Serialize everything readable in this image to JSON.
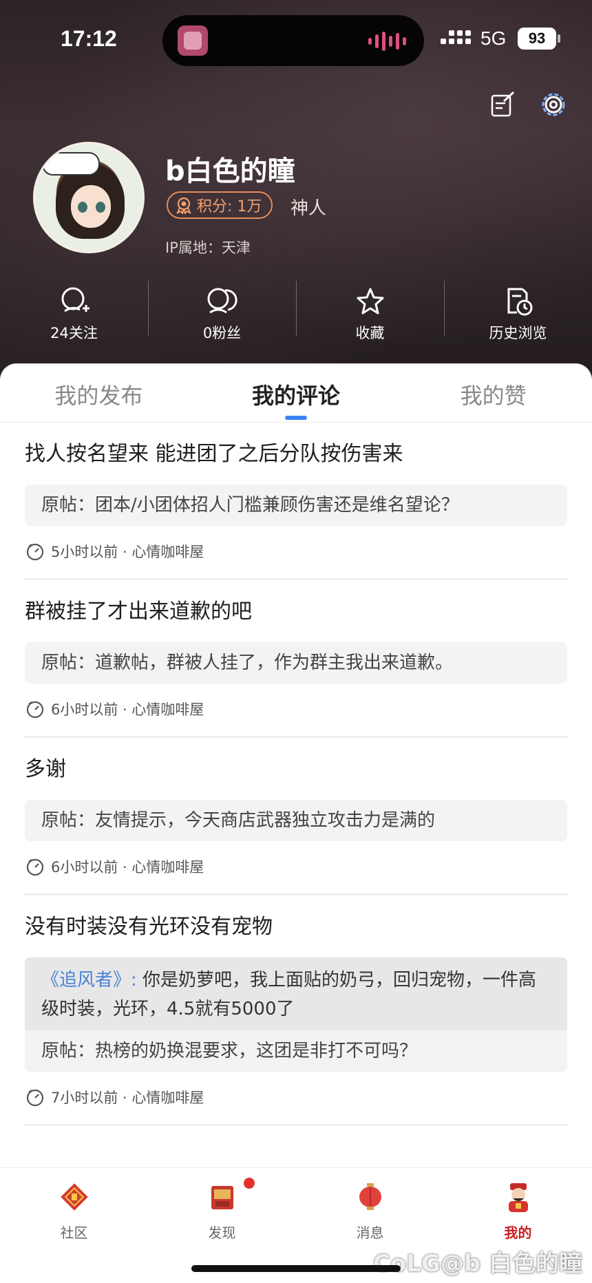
{
  "status_bar": {
    "time": "17:12",
    "network": "5G",
    "battery": "93"
  },
  "profile": {
    "username": "b白色的瞳",
    "points_label": "积分: 1万",
    "rank": "神人",
    "ip_location": "IP属地：天津"
  },
  "stats": [
    {
      "label": "24关注",
      "icon": "user-add-icon"
    },
    {
      "label": "0粉丝",
      "icon": "users-icon"
    },
    {
      "label": "收藏",
      "icon": "star-icon"
    },
    {
      "label": "历史浏览",
      "icon": "history-icon"
    }
  ],
  "tabs": [
    {
      "label": "我的发布",
      "active": false
    },
    {
      "label": "我的评论",
      "active": true
    },
    {
      "label": "我的赞",
      "active": false
    }
  ],
  "comments": [
    {
      "text": "找人按名望来 能进团了之后分队按伤害来",
      "original": "原帖：团本/小团体招人门槛兼顾伤害还是维名望论？",
      "meta": "5小时以前 · 心情咖啡屋"
    },
    {
      "text": "群被挂了才出来道歉的吧",
      "original": "原帖：道歉帖，群被人挂了，作为群主我出来道歉。",
      "meta": "6小时以前 · 心情咖啡屋"
    },
    {
      "text": "多谢",
      "original": "原帖：友情提示，今天商店武器独立攻击力是满的",
      "meta": "6小时以前 · 心情咖啡屋"
    },
    {
      "text": "没有时装没有光环没有宠物",
      "quote_title": "《追风者》:",
      "quote_text": " 你是奶萝吧，我上面贴的奶弓，回归宠物，一件高级时装，光环，4.5就有5000了",
      "original": "原帖：热榜的奶换混要求，这团是非打不可吗？",
      "meta": "7小时以前 · 心情咖啡屋"
    }
  ],
  "nav": [
    {
      "label": "社区",
      "icon": "fu-icon",
      "active": false
    },
    {
      "label": "发现",
      "icon": "discover-icon",
      "active": false,
      "badge": true
    },
    {
      "label": "消息",
      "icon": "lantern-icon",
      "active": false
    },
    {
      "label": "我的",
      "icon": "mascot-icon",
      "active": true
    }
  ],
  "watermark": "CoLG@b 白色的瞳",
  "colors": {
    "accent": "#3d84f3",
    "points": "#e58d5a",
    "nav_active": "#c7201f",
    "quote_title": "#4a83d6"
  }
}
